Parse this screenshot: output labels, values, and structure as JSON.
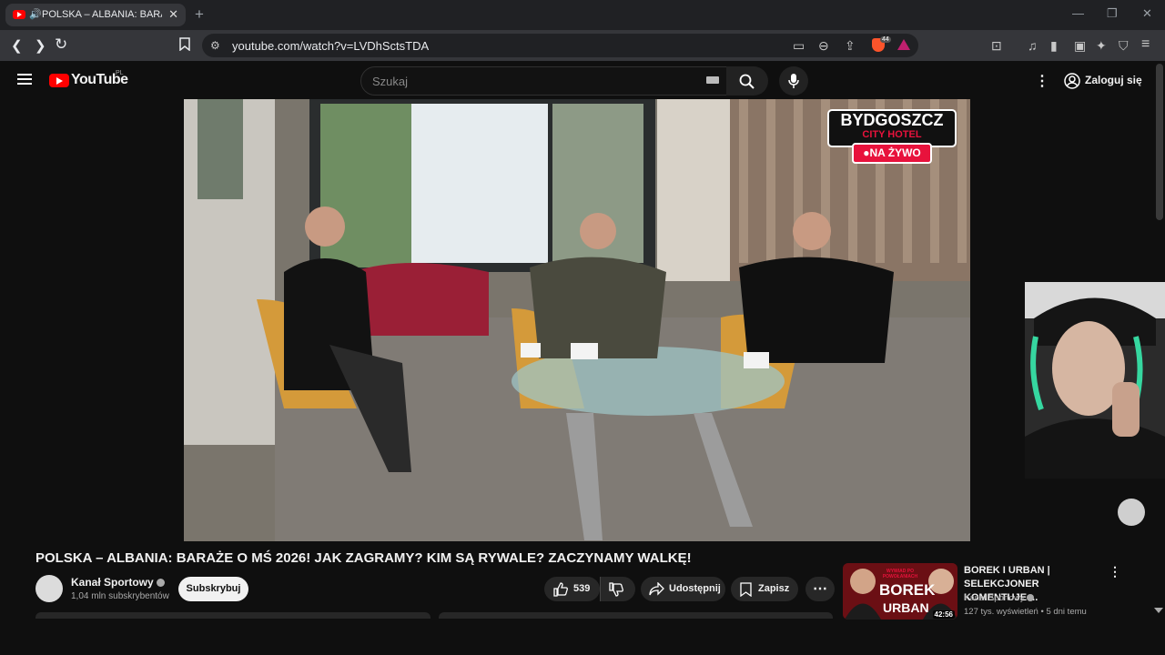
{
  "browser": {
    "tab_title": "POLSKA – ALBANIA: BARAŻE",
    "url": "youtube.com/watch?v=LVDhSctsTDA",
    "brave_badge": "44"
  },
  "youtube": {
    "logo_text": "YouTube",
    "country_code": "PL",
    "search_placeholder": "Szukaj",
    "login_label": "Zaloguj się"
  },
  "video": {
    "overlay_line1": "BYDGOSZCZ",
    "overlay_line2": "CITY HOTEL",
    "overlay_live": "●NA ŻYWO",
    "title": "POLSKA – ALBANIA: BARAŻE O MŚ 2026! JAK ZAGRAMY? KIM SĄ RYWALE? ZACZYNAMY WALKĘ!"
  },
  "channel": {
    "name": "Kanał Sportowy",
    "subscribers": "1,04 mln subskrybentów",
    "subscribe_label": "Subskrybuj"
  },
  "actions": {
    "likes": "539",
    "share_label": "Udostępnij",
    "save_label": "Zapisz"
  },
  "related": {
    "title": "BOREK I URBAN | SELEKCJONER KOMENTUJE ...",
    "channel": "Kanał Sportowy",
    "meta": "127 tys. wyświetleń • 5 dni temu",
    "duration": "42:56",
    "thumb_small": "WYWIAD PO POWOŁANIACH",
    "thumb_big1": "BOREK",
    "thumb_big2": "URBAN"
  },
  "colors": {
    "accent": "#ff0000",
    "live_red": "#e8123c",
    "background": "#0f0f0f"
  }
}
